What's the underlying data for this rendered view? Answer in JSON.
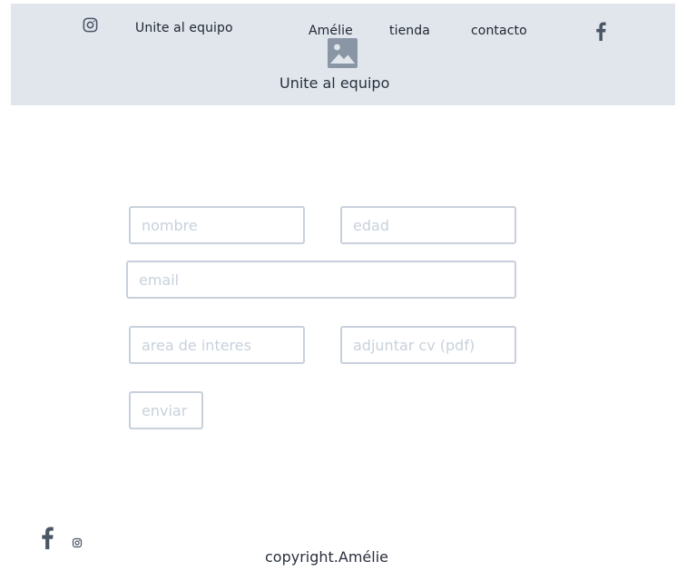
{
  "header": {
    "nav": {
      "join_label": "Unite al equipo",
      "brand_label": "Amélie",
      "shop_label": "tienda",
      "contact_label": "contacto"
    },
    "icons": {
      "instagram": "instagram-icon",
      "facebook": "facebook-icon",
      "image_placeholder": "image-icon"
    },
    "title": "Unite al equipo",
    "background_color": "#e1e6ed"
  },
  "form": {
    "nombre": {
      "placeholder": "nombre",
      "value": ""
    },
    "edad": {
      "placeholder": "edad",
      "value": ""
    },
    "email": {
      "placeholder": "email",
      "value": ""
    },
    "area": {
      "placeholder": "area de interes",
      "value": ""
    },
    "cv": {
      "placeholder": "adjuntar cv (pdf)",
      "value": ""
    },
    "submit_label": "enviar",
    "border_color": "#c8d0db",
    "placeholder_color": "#c8d1dc"
  },
  "footer": {
    "icons": {
      "facebook": "facebook-icon",
      "instagram": "instagram-icon"
    },
    "copyright": "copyright.Amélie"
  }
}
